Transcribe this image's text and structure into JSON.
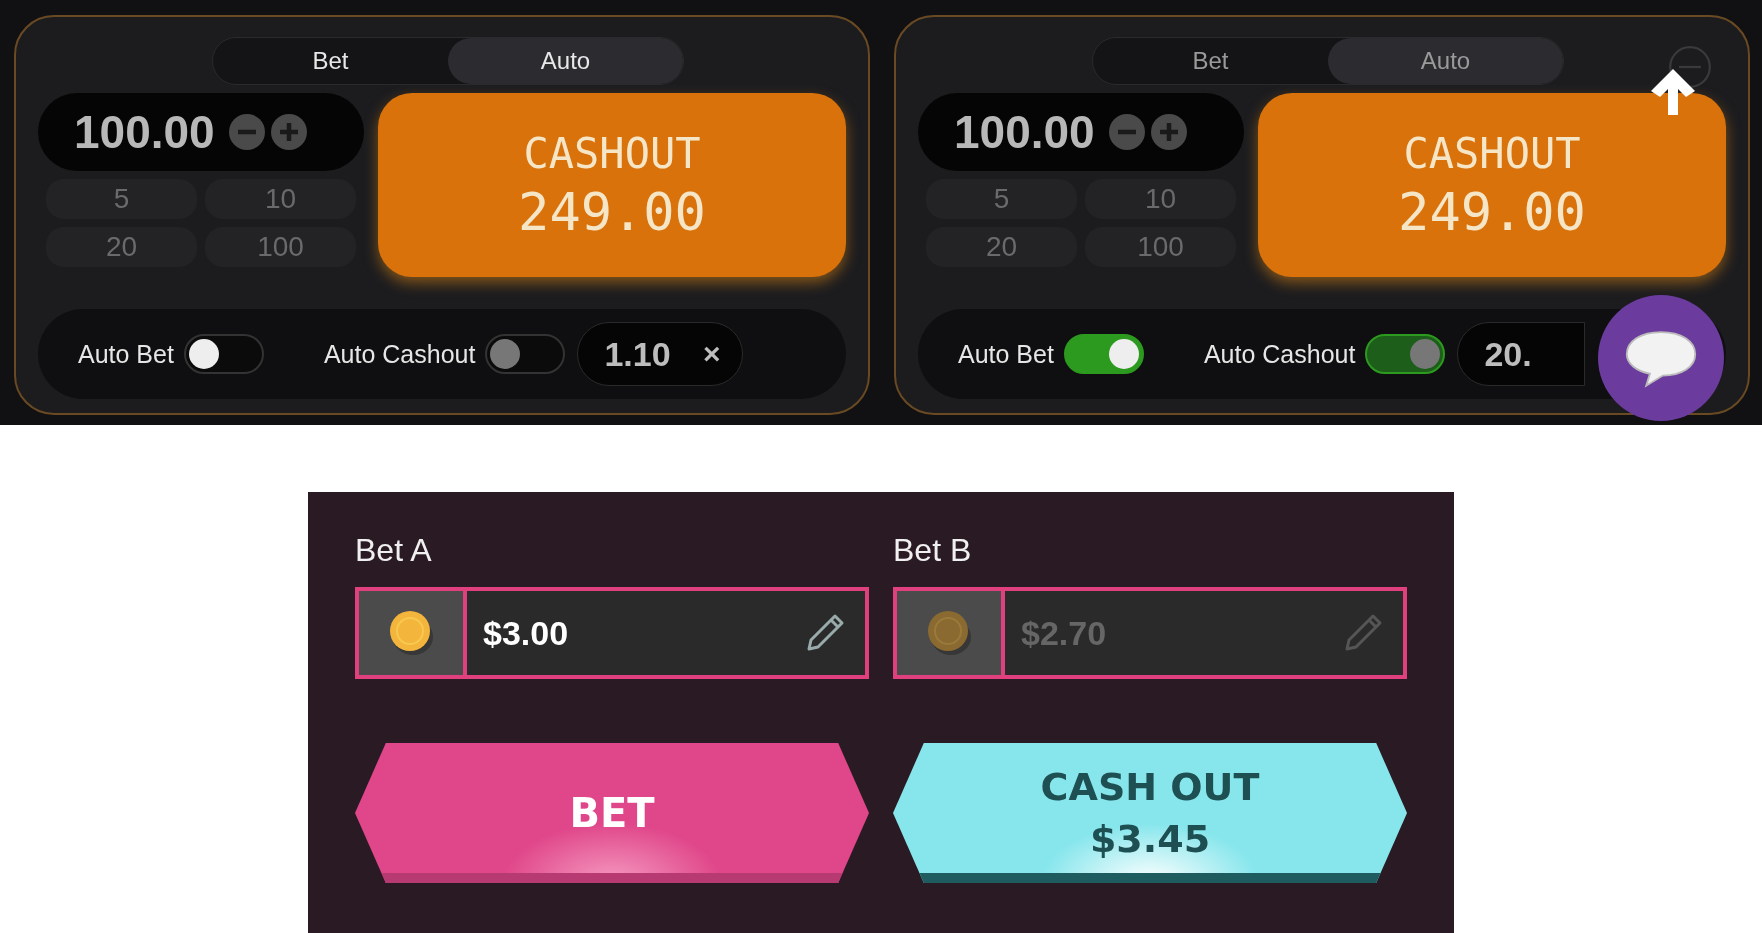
{
  "top_panels": [
    {
      "tabs": [
        {
          "label": "Bet",
          "selected": false
        },
        {
          "label": "Auto",
          "selected": true
        }
      ],
      "amount": "100.00",
      "chips": [
        "5",
        "10",
        "20",
        "100"
      ],
      "cashout": {
        "label": "CASHOUT",
        "value": "249.00"
      },
      "auto_bet": {
        "label": "Auto Bet",
        "on": false
      },
      "auto_cashout": {
        "label": "Auto Cashout",
        "on": false
      },
      "multiplier": "1.10",
      "clear": "×",
      "overlays": false
    },
    {
      "tabs": [
        {
          "label": "Bet",
          "selected": false
        },
        {
          "label": "Auto",
          "selected": true
        }
      ],
      "amount": "100.00",
      "chips": [
        "5",
        "10",
        "20",
        "100"
      ],
      "cashout": {
        "label": "CASHOUT",
        "value": "249.00"
      },
      "auto_bet": {
        "label": "Auto Bet",
        "on": true
      },
      "auto_cashout": {
        "label": "Auto Cashout",
        "on": true
      },
      "multiplier": "20.",
      "overlays": true
    }
  ],
  "bet_panel": {
    "bets": [
      {
        "label": "Bet A",
        "value": "$3.00",
        "disabled": false
      },
      {
        "label": "Bet B",
        "value": "$2.70",
        "disabled": true
      }
    ],
    "buttons": [
      {
        "kind": "bet",
        "label": "BET"
      },
      {
        "kind": "cashout",
        "label": "CASH OUT",
        "value": "$3.45"
      }
    ]
  }
}
